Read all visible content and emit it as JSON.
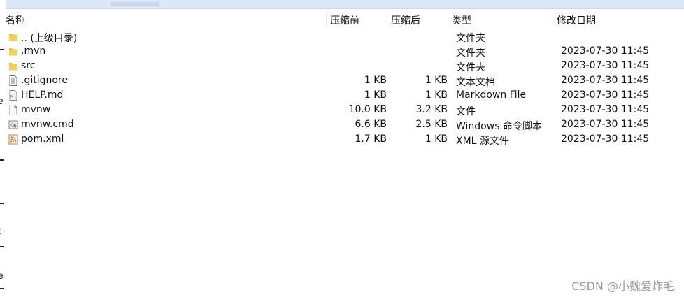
{
  "columns": {
    "name": "名称",
    "size": "压缩前",
    "compressed": "压缩后",
    "type": "类型",
    "modified": "修改日期"
  },
  "files": [
    {
      "name": ".. (上级目录)",
      "size": "",
      "compressed": "",
      "type": "文件夹",
      "modified": "",
      "icon": "folder-icon"
    },
    {
      "name": ".mvn",
      "size": "",
      "compressed": "",
      "type": "文件夹",
      "modified": "2023-07-30 11:45",
      "icon": "folder-icon"
    },
    {
      "name": "src",
      "size": "",
      "compressed": "",
      "type": "文件夹",
      "modified": "2023-07-30 11:45",
      "icon": "folder-icon"
    },
    {
      "name": ".gitignore",
      "size": "1 KB",
      "compressed": "1 KB",
      "type": "文本文档",
      "modified": "2023-07-30 11:45",
      "icon": "text-file-icon"
    },
    {
      "name": "HELP.md",
      "size": "1 KB",
      "compressed": "1 KB",
      "type": "Markdown File",
      "modified": "2023-07-30 11:45",
      "icon": "markdown-file-icon"
    },
    {
      "name": "mvnw",
      "size": "10.0 KB",
      "compressed": "3.2 KB",
      "type": "文件",
      "modified": "2023-07-30 11:45",
      "icon": "blank-file-icon"
    },
    {
      "name": "mvnw.cmd",
      "size": "6.6 KB",
      "compressed": "2.5 KB",
      "type": "Windows 命令脚本",
      "modified": "2023-07-30 11:45",
      "icon": "cmd-script-icon"
    },
    {
      "name": "pom.xml",
      "size": "1.7 KB",
      "compressed": "1 KB",
      "type": "XML 源文件",
      "modified": "2023-07-30 11:45",
      "icon": "xml-file-icon"
    }
  ],
  "left_edge_glyphs": [
    "e",
    "t",
    "e"
  ],
  "watermark": "CSDN @小魏爱炸毛"
}
